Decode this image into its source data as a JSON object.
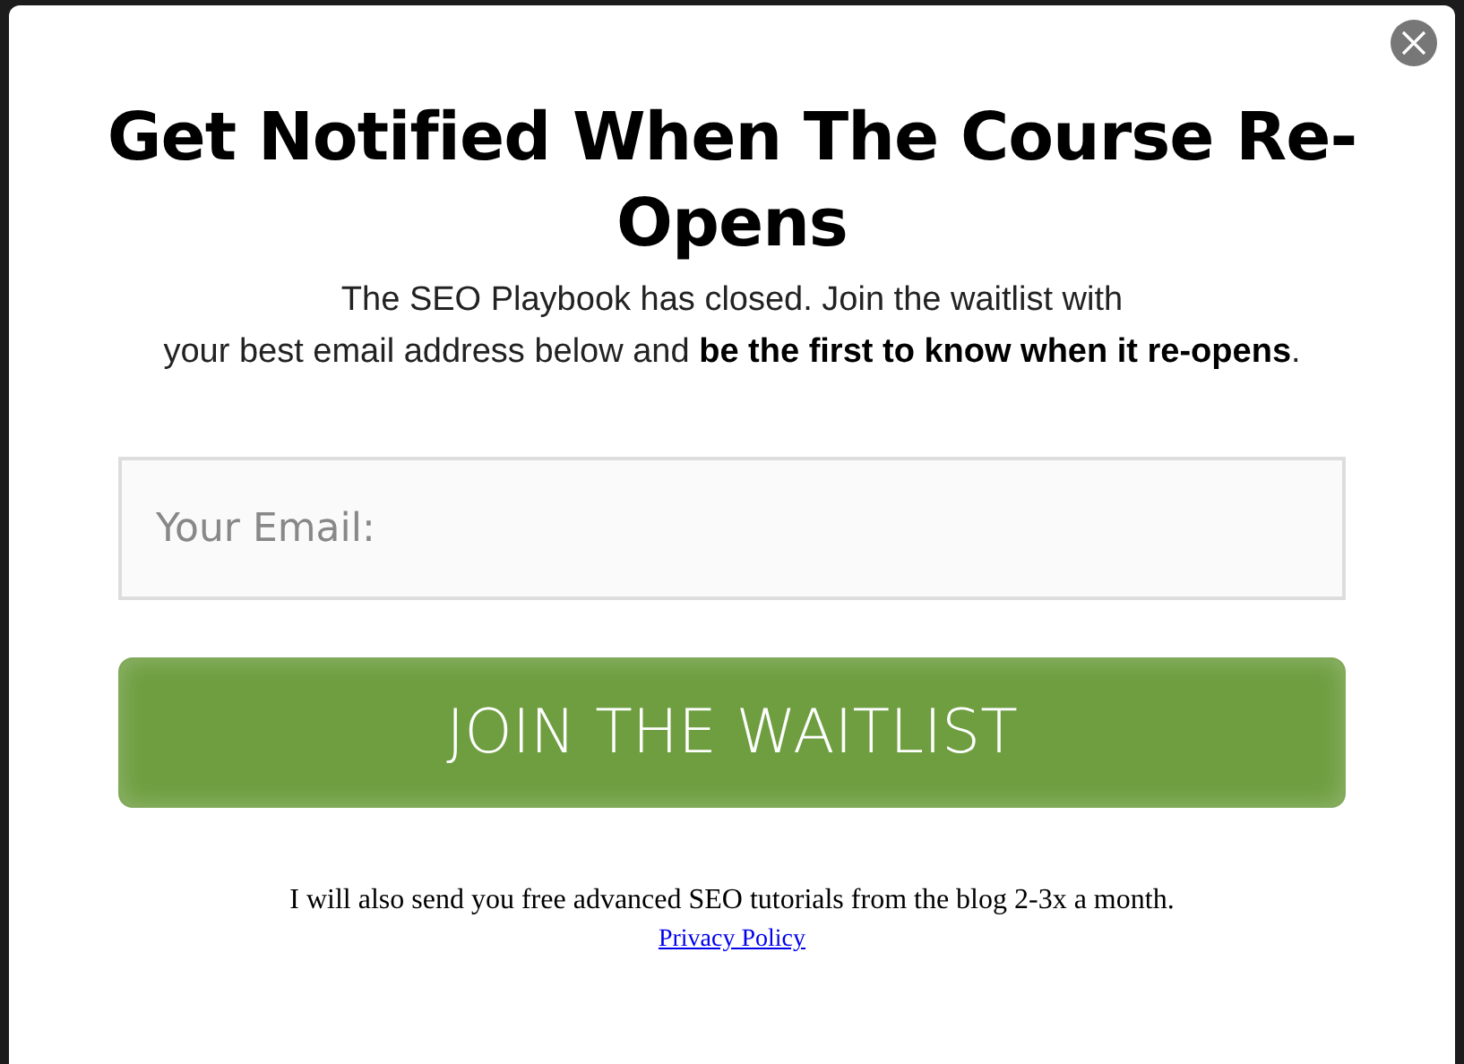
{
  "title": "Get Notified When The Course Re-Opens",
  "subtitle_lines": [
    "The SEO Playbook has closed. Join the waitlist with",
    "your best email address below and **be the first to know when it re-opens**."
  ],
  "email_field": {
    "placeholder": "Your Email:"
  },
  "submit_button": {
    "label": "JOIN THE WAITLIST"
  },
  "footer_note": "I will also send you free advanced SEO tutorials from the blog 2-3x a month.",
  "privacy_link": "Privacy Policy"
}
